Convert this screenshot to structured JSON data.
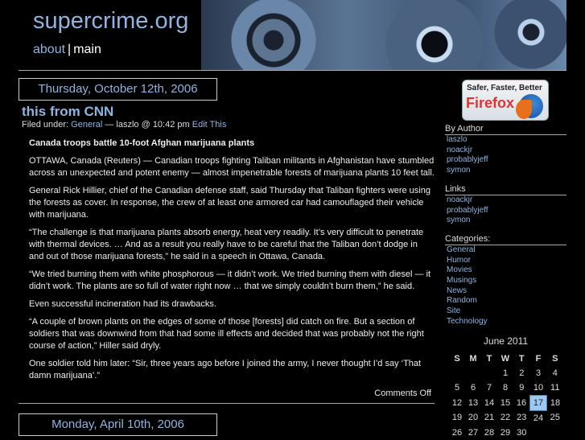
{
  "header": {
    "site_title": "supercrime.org",
    "nav": {
      "about": "about",
      "sep": "|",
      "main": "main"
    }
  },
  "post": {
    "date": "Thursday, October 12th, 2006",
    "title": "this from CNN",
    "meta": {
      "filed_under": "Filed under:",
      "category": "General",
      "author": "— laszlo @ 10:42 pm",
      "edit": "Edit This"
    },
    "headline": "Canada troops battle 10-foot Afghan marijuana plants",
    "paragraphs": [
      "OTTAWA, Canada (Reuters) — Canadian troops fighting Taliban militants in Afghanistan have stumbled across an unexpected and potent enemy — almost impenetrable forests of marijuana plants 10 feet tall.",
      "General Rick Hillier, chief of the Canadian defense staff, said Thursday that Taliban fighters were using the forests as cover. In response, the crew of at least one armored car had camouflaged their vehicle with marijuana.",
      "“The challenge is that marijuana plants absorb energy, heat very readily. It’s very difficult to penetrate with thermal devices. … And as a result you really have to be careful that the Taliban don’t dodge in and out of those marijuana forests,” he said in a speech in Ottawa, Canada.",
      "“We tried burning them with white phosphorous — it didn’t work. We tried burning them with diesel — it didn’t work. The plants are so full of water right now … that we simply couldn’t burn them,” he said.",
      "Even successful incineration had its drawbacks.",
      "“A couple of brown plants on the edges of some of those [forests] did catch on fire. But a section of soldiers that was downwind from that had some ill effects and decided that was probably not the right course of action,” Hiller said dryly.",
      "One soldier told him later: “Sir, three years ago before I joined the army, I never thought I’d say ‘That damn marijuana’.”"
    ],
    "comments": "Comments Off"
  },
  "next_post": {
    "date": "Monday, April 10th, 2006"
  },
  "sidebar": {
    "firefox": {
      "line1": "Safer, Faster, Better",
      "line2": "Firefox"
    },
    "by_author": {
      "title": "By Author",
      "items": [
        "laszlo",
        "noackjr",
        "probablyjeff",
        "symon"
      ]
    },
    "links": {
      "title": "Links",
      "items": [
        "noackjr",
        "probablyjeff",
        "symon"
      ]
    },
    "categories": {
      "title": "Categories:",
      "items": [
        "General",
        "Humor",
        "Movies",
        "Musings",
        "News",
        "Random",
        "Site",
        "Technology"
      ]
    },
    "calendar": {
      "caption": "June 2011",
      "days": [
        "S",
        "M",
        "T",
        "W",
        "T",
        "F",
        "S"
      ],
      "today": "17",
      "weeks": [
        [
          "",
          "",
          "",
          "1",
          "2",
          "3",
          "4"
        ],
        [
          "5",
          "6",
          "7",
          "8",
          "9",
          "10",
          "11"
        ],
        [
          "12",
          "13",
          "14",
          "15",
          "16",
          "17",
          "18"
        ],
        [
          "19",
          "20",
          "21",
          "22",
          "23",
          "24",
          "25"
        ],
        [
          "26",
          "27",
          "28",
          "29",
          "30",
          "",
          ""
        ]
      ]
    }
  }
}
